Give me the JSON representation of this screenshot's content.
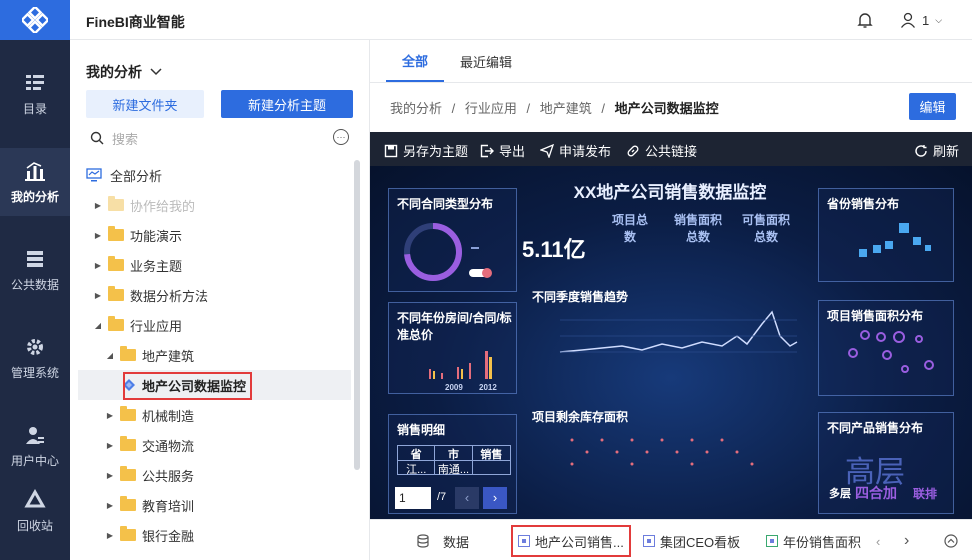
{
  "app": {
    "title": "FineBI商业智能",
    "user": "1"
  },
  "nav": {
    "items": [
      {
        "label": "目录",
        "icon": "catalog-icon"
      },
      {
        "label": "我的分析",
        "icon": "analysis-icon",
        "active": true
      },
      {
        "label": "公共数据",
        "icon": "database-icon"
      },
      {
        "label": "管理系统",
        "icon": "gear-icon"
      },
      {
        "label": "用户中心",
        "icon": "user-icon"
      },
      {
        "label": "回收站",
        "icon": "recycle-icon"
      }
    ]
  },
  "tree_panel": {
    "title": "我的分析",
    "new_folder": "新建文件夹",
    "new_topic": "新建分析主题",
    "search_placeholder": "搜索",
    "items": [
      {
        "label": "全部分析"
      },
      {
        "label": "协作给我的"
      },
      {
        "label": "功能演示"
      },
      {
        "label": "业务主题"
      },
      {
        "label": "数据分析方法"
      },
      {
        "label": "行业应用"
      },
      {
        "label": "地产建筑"
      },
      {
        "label": "地产公司数据监控"
      },
      {
        "label": "机械制造"
      },
      {
        "label": "交通物流"
      },
      {
        "label": "公共服务"
      },
      {
        "label": "教育培训"
      },
      {
        "label": "银行金融"
      }
    ]
  },
  "main": {
    "tabs": [
      "全部",
      "最近编辑"
    ],
    "breadcrumb": [
      "我的分析",
      "行业应用",
      "地产建筑"
    ],
    "breadcrumb_current": "地产公司数据监控",
    "edit": "编辑"
  },
  "dashboard": {
    "toolbar": [
      "另存为主题",
      "导出",
      "申请发布",
      "公共链接",
      "刷新"
    ],
    "title": "XX地产公司销售数据监控",
    "panels": {
      "contract_type": "不同合同类型分布",
      "province": "省份销售分布",
      "yearly": "不同年份房间/合同/标准总价",
      "project_area": "项目销售面积分布",
      "sales_detail": "销售明细",
      "product": "不同产品销售分布",
      "quarter_trend": "不同季度销售趋势",
      "inventory": "项目剩余库存面积"
    },
    "kpis": {
      "big_number": "5.11亿",
      "project_total": "项目总数",
      "sales_area": "销售面积总数",
      "sellable_area": "可售面积总数"
    },
    "table": {
      "headers": [
        "省",
        "市",
        "销售"
      ],
      "row": [
        "江...",
        "南通...",
        ""
      ]
    },
    "pager": {
      "page": "1",
      "total": "/7"
    },
    "axis_years": [
      "2009",
      "2012"
    ],
    "word_big": "高层",
    "word_row": [
      "多层",
      "四合加",
      "联排"
    ]
  },
  "bottom_tabs": {
    "data": "数据",
    "tabs": [
      "地产公司销售...",
      "集团CEO看板",
      "年份销售面积"
    ]
  }
}
